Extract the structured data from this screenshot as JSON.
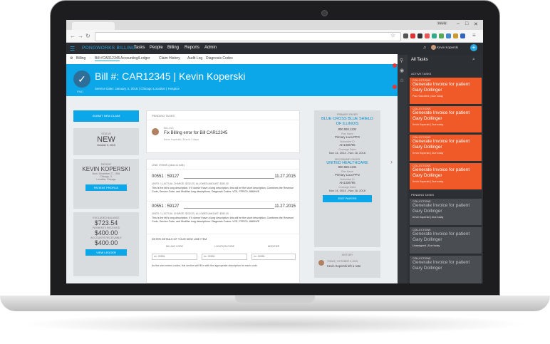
{
  "browser": {
    "tab_label": "",
    "window_controls": [
      "–",
      "□",
      "✕"
    ],
    "user_badge": "Kevin"
  },
  "app": {
    "brand": "PONGWORKS BILLING",
    "nav": [
      "Tasks",
      "People",
      "Billing",
      "Reports",
      "Admin"
    ],
    "user_name": "Kevin Koperski"
  },
  "subnav": {
    "items": [
      "Billing",
      "Bill #CAR12345",
      "Accounting/Ledger",
      "Claim History",
      "Audit Log",
      "Diagnosis Codes"
    ]
  },
  "banner": {
    "title": "Bill #: CAR12345  |  Kevin Koperski",
    "subtitle": "Service Date: January 3, 2015  |  Chicago Location  |  Hospice",
    "status": "PAID"
  },
  "left": {
    "submit_button": "SUBMIT NEW CLAIM",
    "status_label": "STATUS",
    "status_value": "NEW",
    "status_date": "October 9, 2015",
    "patient_label": "PATIENT",
    "patient_name": "KEVIN KOPERSKI",
    "patient_line1": "Born: December 27, 1984",
    "patient_line2": "Chicago, IL",
    "patient_line3": "Location: Chicago",
    "patient_button": "PATIENT PROFILE",
    "balance_label": "EXCLUDED BALANCE",
    "balance_value": "$723.54",
    "payments_label": "PAYMENTS RECEIVED",
    "payments_value": "$400.00",
    "receivable_label": "ACCOUNTS RECEIVABLE",
    "receivable_value": "$400.00",
    "ledger_button": "VIEW LEDGER"
  },
  "mid": {
    "pending_header": "PENDING TASKS",
    "pending_tag": "BILLING",
    "pending_title": "Fix Billing error for Bill CAR12345",
    "pending_meta": "Kevin Koperski  |  Due in 2 days",
    "line_items_header": "LINE ITEMS (click to edit)",
    "items": [
      {
        "code": "00551 : 59127",
        "date": "11.27.2015",
        "meta": "UNITS: 1  |  ACTUAL CHARGE: $232.87  |  ALLOWED AMOUNT: $280.00",
        "desc": "This is the bill's long description. If it doesn't have a long description, this will be the short description. Combines the Revenue Code, Service Code, and Modifier long descriptions. Diagnosis Codes:  VCE, FPRCD, 888/HVE"
      },
      {
        "code": "00551 : 59127",
        "date": "11.27.2015",
        "meta": "UNITS: 1  |  ACTUAL CHARGE: $232.87  |  ALLOWED AMOUNT: $280.00",
        "desc": "This is the bill's long description. If it doesn't have a long description, this will be the short description. Combines the Revenue Code, Service Code, and Modifier long descriptions. Diagnosis Codes:  VCE, FPRCD, 888/HVE"
      }
    ],
    "enter_header": "ENTER DETAILS OF YOUR NEW LINE ITEM",
    "billing_code_label": "BILLING CODE",
    "location_code_label": "LOCATION CODE",
    "modifier_label": "MODIFIER",
    "billing_placeholder": "ex. 00551",
    "location_placeholder": "ex. 00551",
    "modifier_placeholder": "ex. 00551",
    "footer_note": "As the user enters codes, this section will fill in with the appropriate description for each code."
  },
  "right": {
    "primary_label": "PRIMARY PAYER",
    "primary_name": "BLUE CROSS BLUE SHIELD OF ILLINOIS",
    "primary_phone": "800.555.1234",
    "plan_label": "Plan Name",
    "plan_value": "Primary Luca PPO",
    "subscriber_label": "Subscriber ID",
    "subscriber_value": "AH1336795",
    "coverage_label": "Coverage Dates",
    "coverage_value": "Nov 14, 2014 - Nov 16, 2016",
    "secondary_label": "SECONDARY PAYER",
    "secondary_name": "UNITED HEALTHCARE",
    "secondary_phone": "800.555.1234",
    "plan2_label": "Plan Name",
    "plan2_value": "Primary Luca PPO",
    "subscriber2_label": "Subscriber ID",
    "subscriber2_value": "AH1336795",
    "coverage2_label": "Coverage Dates",
    "coverage2_value": "Nov 14, 2014 - Nov 16, 2016",
    "edit_payers": "EDIT PAYERS",
    "history_label": "HISTORY",
    "history_date": "TODAY  |  OCTOBER 9, 2015",
    "history_text": "Kevin Koperski left a note"
  },
  "sidebar": {
    "title": "All Tasks",
    "active_header": "ACTIVE TASKS",
    "pending_header": "PENDING TASKS",
    "active_tasks": [
      {
        "tag": "COLLECTIONS",
        "name": "Generate Invoice for patient Gary Dollinger",
        "meta": "Paul Saunders  |  Due today"
      },
      {
        "tag": "COLLECTIONS",
        "name": "Generate Invoice for patient Gary Dollinger",
        "meta": "Kevin Koperski  |  Due today"
      },
      {
        "tag": "COLLECTIONS",
        "name": "Generate Invoice for patient Gary Dollinger",
        "meta": "Kevin Koperski  |  Due today"
      },
      {
        "tag": "COLLECTIONS",
        "name": "Generate Invoice for patient Gary Dollinger",
        "meta": "Kevin Koperski  |  Due today"
      }
    ],
    "pending_tasks": [
      {
        "tag": "COLLECTIONS",
        "name": "Generate Invoice for patient Gary Dollinger",
        "meta": "Kevin Koperski  |  Due today"
      },
      {
        "tag": "COLLECTIONS",
        "name": "Generate Invoice for patient Gary Dollinger",
        "meta": "Unassigned  |  Due today"
      },
      {
        "tag": "COLLECTIONS",
        "name": "Generate Invoice for patient Gary Dollinger",
        "meta": ""
      }
    ]
  },
  "colors": {
    "accent": "#0ba7e8",
    "task_active": "#f05a28",
    "task_pending": "#4a4d52",
    "appbar": "#2a2e33"
  }
}
